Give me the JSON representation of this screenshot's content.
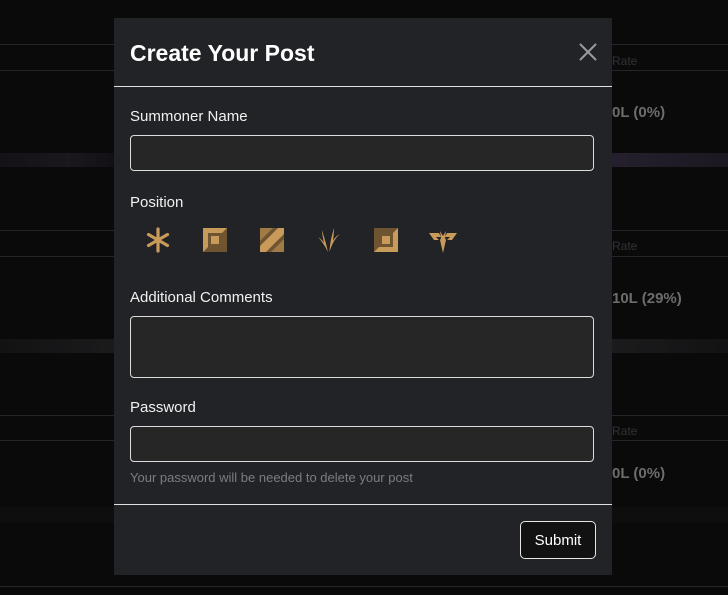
{
  "background": {
    "rows": [
      {
        "win_rate_header": "Rate",
        "record": "0L (0%)"
      },
      {
        "win_rate_header": "Rate",
        "record": "10L (29%)"
      },
      {
        "win_rate_header": "Rate",
        "record": "0L (0%)"
      }
    ]
  },
  "modal": {
    "title": "Create Your Post",
    "summoner_label": "Summoner Name",
    "summoner_value": "",
    "position_label": "Position",
    "positions": [
      {
        "icon": "fill-icon"
      },
      {
        "icon": "top-lane-icon"
      },
      {
        "icon": "mid-lane-icon"
      },
      {
        "icon": "jungle-icon"
      },
      {
        "icon": "bot-lane-icon"
      },
      {
        "icon": "support-icon"
      }
    ],
    "comments_label": "Additional Comments",
    "comments_value": "",
    "password_label": "Password",
    "password_value": "",
    "password_help": "Your password will be needed to delete your post",
    "submit_label": "Submit"
  },
  "colors": {
    "modal_bg": "#212327",
    "icon_gold": "#c89b5a",
    "icon_dark": "#6e5430"
  }
}
